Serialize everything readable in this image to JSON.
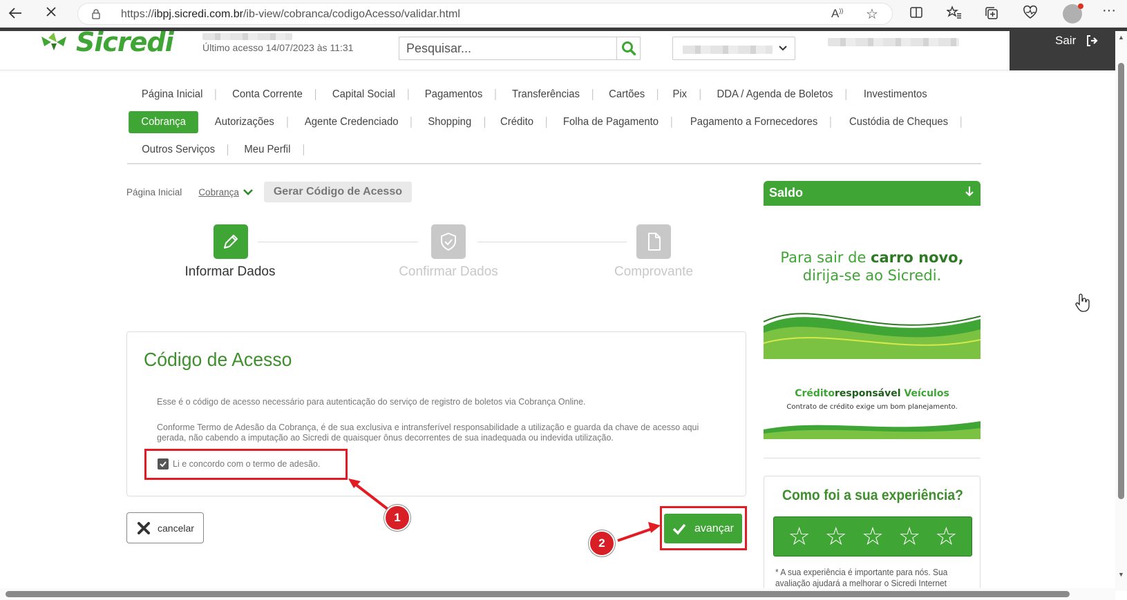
{
  "browser": {
    "url_scheme": "https://",
    "url_host": "ibpj.sicredi.com.br",
    "url_path": "/ib-view/cobranca/codigoAcesso/validar.html"
  },
  "header": {
    "brand": "Sicredi",
    "last_access": "Último acesso 14/07/2023 às 11:31",
    "search_placeholder": "Pesquisar...",
    "logout_label": "Sair"
  },
  "menu": {
    "row1": [
      "Página Inicial",
      "Conta Corrente",
      "Capital Social",
      "Pagamentos",
      "Transferências",
      "Cartões",
      "Pix",
      "DDA / Agenda de Boletos",
      "Investimentos"
    ],
    "row2": [
      "Cobrança",
      "Autorizações",
      "Agente Credenciado",
      "Shopping",
      "Crédito",
      "Folha de Pagamento",
      "Pagamento a Fornecedores",
      "Custódia de Cheques"
    ],
    "row3": [
      "Outros Serviços",
      "Meu Perfil"
    ],
    "active": "Cobrança"
  },
  "breadcrumb": {
    "home": "Página Inicial",
    "section": "Cobrança",
    "current": "Gerar Código de Acesso"
  },
  "steps": [
    {
      "label": "Informar Dados",
      "state": "active"
    },
    {
      "label": "Confirmar Dados",
      "state": "inactive"
    },
    {
      "label": "Comprovante",
      "state": "inactive"
    }
  ],
  "card": {
    "title": "Código de Acesso",
    "paragraph1": "Esse é o código de acesso necessário para autenticação do serviço de registro de boletos via Cobrança Online.",
    "paragraph2": "Conforme Termo de Adesão da Cobrança, é de sua exclusiva e intransferível responsabilidade a utilização e guarda da chave de acesso aqui gerada, não cabendo a imputação ao Sicredi de quaisquer ônus decorrentes de sua inadequada ou indevida utilização.",
    "checkbox_label": "Li e concordo com o termo de adesão.",
    "checkbox_checked": true
  },
  "actions": {
    "cancel_label": "cancelar",
    "advance_label": "avançar"
  },
  "annotations": {
    "badge1": "1",
    "badge2": "2",
    "color": "#e31b23"
  },
  "sidebar": {
    "saldo_label": "Saldo",
    "ad_line1_a": "Para sair de ",
    "ad_line1_b": "carro novo,",
    "ad_line2": "dirija-se ao Sicredi.",
    "ad_brand_a": "Crédito",
    "ad_brand_b": "responsável",
    "ad_brand_c": "Veículos",
    "ad_sub": "Contrato de crédito exige um bom planejamento.",
    "feedback_title": "Como foi a sua experiência?",
    "feedback_note": "* A sua experiência é importante para nós. Sua avaliação ajudará a melhorar o Sicredi Internet",
    "star_count": 5
  },
  "colors": {
    "brand_green": "#3fa535",
    "dark_green": "#2e7a24",
    "inactive_step": "#c8c8c8"
  }
}
